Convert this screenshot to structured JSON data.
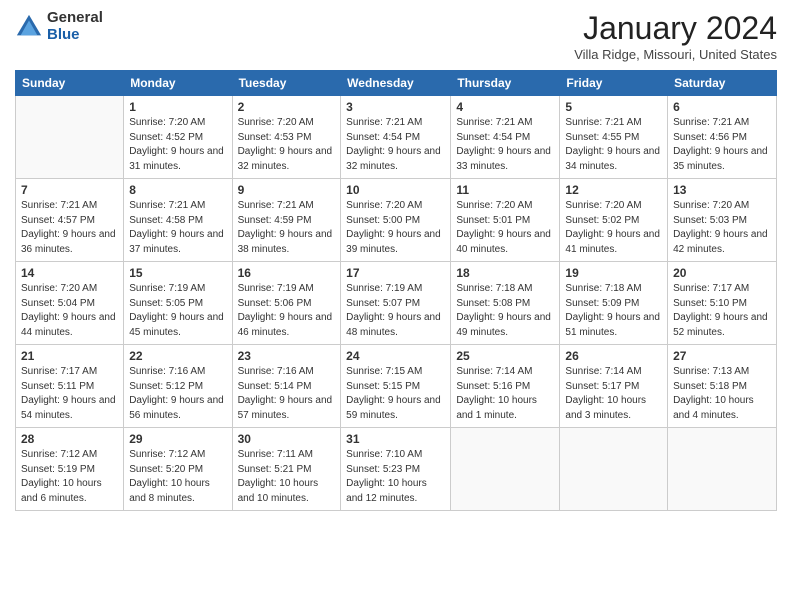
{
  "header": {
    "logo_general": "General",
    "logo_blue": "Blue",
    "month_title": "January 2024",
    "location": "Villa Ridge, Missouri, United States"
  },
  "weekdays": [
    "Sunday",
    "Monday",
    "Tuesday",
    "Wednesday",
    "Thursday",
    "Friday",
    "Saturday"
  ],
  "weeks": [
    [
      {
        "day": "",
        "sunrise": "",
        "sunset": "",
        "daylight": ""
      },
      {
        "day": "1",
        "sunrise": "Sunrise: 7:20 AM",
        "sunset": "Sunset: 4:52 PM",
        "daylight": "Daylight: 9 hours and 31 minutes."
      },
      {
        "day": "2",
        "sunrise": "Sunrise: 7:20 AM",
        "sunset": "Sunset: 4:53 PM",
        "daylight": "Daylight: 9 hours and 32 minutes."
      },
      {
        "day": "3",
        "sunrise": "Sunrise: 7:21 AM",
        "sunset": "Sunset: 4:54 PM",
        "daylight": "Daylight: 9 hours and 32 minutes."
      },
      {
        "day": "4",
        "sunrise": "Sunrise: 7:21 AM",
        "sunset": "Sunset: 4:54 PM",
        "daylight": "Daylight: 9 hours and 33 minutes."
      },
      {
        "day": "5",
        "sunrise": "Sunrise: 7:21 AM",
        "sunset": "Sunset: 4:55 PM",
        "daylight": "Daylight: 9 hours and 34 minutes."
      },
      {
        "day": "6",
        "sunrise": "Sunrise: 7:21 AM",
        "sunset": "Sunset: 4:56 PM",
        "daylight": "Daylight: 9 hours and 35 minutes."
      }
    ],
    [
      {
        "day": "7",
        "sunrise": "Sunrise: 7:21 AM",
        "sunset": "Sunset: 4:57 PM",
        "daylight": "Daylight: 9 hours and 36 minutes."
      },
      {
        "day": "8",
        "sunrise": "Sunrise: 7:21 AM",
        "sunset": "Sunset: 4:58 PM",
        "daylight": "Daylight: 9 hours and 37 minutes."
      },
      {
        "day": "9",
        "sunrise": "Sunrise: 7:21 AM",
        "sunset": "Sunset: 4:59 PM",
        "daylight": "Daylight: 9 hours and 38 minutes."
      },
      {
        "day": "10",
        "sunrise": "Sunrise: 7:20 AM",
        "sunset": "Sunset: 5:00 PM",
        "daylight": "Daylight: 9 hours and 39 minutes."
      },
      {
        "day": "11",
        "sunrise": "Sunrise: 7:20 AM",
        "sunset": "Sunset: 5:01 PM",
        "daylight": "Daylight: 9 hours and 40 minutes."
      },
      {
        "day": "12",
        "sunrise": "Sunrise: 7:20 AM",
        "sunset": "Sunset: 5:02 PM",
        "daylight": "Daylight: 9 hours and 41 minutes."
      },
      {
        "day": "13",
        "sunrise": "Sunrise: 7:20 AM",
        "sunset": "Sunset: 5:03 PM",
        "daylight": "Daylight: 9 hours and 42 minutes."
      }
    ],
    [
      {
        "day": "14",
        "sunrise": "Sunrise: 7:20 AM",
        "sunset": "Sunset: 5:04 PM",
        "daylight": "Daylight: 9 hours and 44 minutes."
      },
      {
        "day": "15",
        "sunrise": "Sunrise: 7:19 AM",
        "sunset": "Sunset: 5:05 PM",
        "daylight": "Daylight: 9 hours and 45 minutes."
      },
      {
        "day": "16",
        "sunrise": "Sunrise: 7:19 AM",
        "sunset": "Sunset: 5:06 PM",
        "daylight": "Daylight: 9 hours and 46 minutes."
      },
      {
        "day": "17",
        "sunrise": "Sunrise: 7:19 AM",
        "sunset": "Sunset: 5:07 PM",
        "daylight": "Daylight: 9 hours and 48 minutes."
      },
      {
        "day": "18",
        "sunrise": "Sunrise: 7:18 AM",
        "sunset": "Sunset: 5:08 PM",
        "daylight": "Daylight: 9 hours and 49 minutes."
      },
      {
        "day": "19",
        "sunrise": "Sunrise: 7:18 AM",
        "sunset": "Sunset: 5:09 PM",
        "daylight": "Daylight: 9 hours and 51 minutes."
      },
      {
        "day": "20",
        "sunrise": "Sunrise: 7:17 AM",
        "sunset": "Sunset: 5:10 PM",
        "daylight": "Daylight: 9 hours and 52 minutes."
      }
    ],
    [
      {
        "day": "21",
        "sunrise": "Sunrise: 7:17 AM",
        "sunset": "Sunset: 5:11 PM",
        "daylight": "Daylight: 9 hours and 54 minutes."
      },
      {
        "day": "22",
        "sunrise": "Sunrise: 7:16 AM",
        "sunset": "Sunset: 5:12 PM",
        "daylight": "Daylight: 9 hours and 56 minutes."
      },
      {
        "day": "23",
        "sunrise": "Sunrise: 7:16 AM",
        "sunset": "Sunset: 5:14 PM",
        "daylight": "Daylight: 9 hours and 57 minutes."
      },
      {
        "day": "24",
        "sunrise": "Sunrise: 7:15 AM",
        "sunset": "Sunset: 5:15 PM",
        "daylight": "Daylight: 9 hours and 59 minutes."
      },
      {
        "day": "25",
        "sunrise": "Sunrise: 7:14 AM",
        "sunset": "Sunset: 5:16 PM",
        "daylight": "Daylight: 10 hours and 1 minute."
      },
      {
        "day": "26",
        "sunrise": "Sunrise: 7:14 AM",
        "sunset": "Sunset: 5:17 PM",
        "daylight": "Daylight: 10 hours and 3 minutes."
      },
      {
        "day": "27",
        "sunrise": "Sunrise: 7:13 AM",
        "sunset": "Sunset: 5:18 PM",
        "daylight": "Daylight: 10 hours and 4 minutes."
      }
    ],
    [
      {
        "day": "28",
        "sunrise": "Sunrise: 7:12 AM",
        "sunset": "Sunset: 5:19 PM",
        "daylight": "Daylight: 10 hours and 6 minutes."
      },
      {
        "day": "29",
        "sunrise": "Sunrise: 7:12 AM",
        "sunset": "Sunset: 5:20 PM",
        "daylight": "Daylight: 10 hours and 8 minutes."
      },
      {
        "day": "30",
        "sunrise": "Sunrise: 7:11 AM",
        "sunset": "Sunset: 5:21 PM",
        "daylight": "Daylight: 10 hours and 10 minutes."
      },
      {
        "day": "31",
        "sunrise": "Sunrise: 7:10 AM",
        "sunset": "Sunset: 5:23 PM",
        "daylight": "Daylight: 10 hours and 12 minutes."
      },
      {
        "day": "",
        "sunrise": "",
        "sunset": "",
        "daylight": ""
      },
      {
        "day": "",
        "sunrise": "",
        "sunset": "",
        "daylight": ""
      },
      {
        "day": "",
        "sunrise": "",
        "sunset": "",
        "daylight": ""
      }
    ]
  ]
}
